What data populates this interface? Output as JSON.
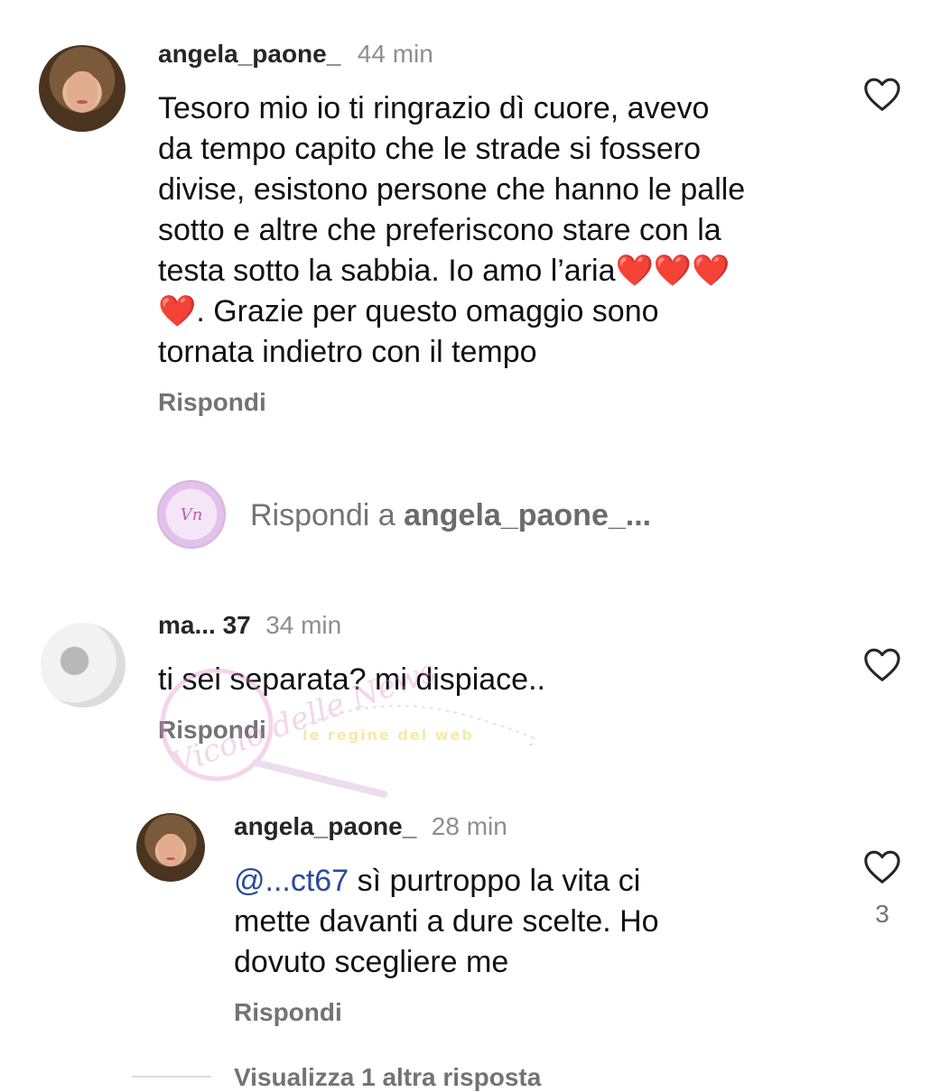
{
  "comments": [
    {
      "username": "angela_paone_",
      "time": "44 min",
      "text_lines": [
        "Tesoro mio io ti ringrazio dì cuore, avevo",
        "da tempo capito che le strade si fossero",
        "divise, esistono persone che hanno le palle",
        "sotto e altre che preferiscono stare con la",
        "testa sotto la sabbia. Io amo l’aria❤️❤️❤️",
        "❤️. Grazie per questo omaggio sono",
        "tornata indietro con il tempo"
      ],
      "reply_label": "Rispondi"
    },
    {
      "username": "ma... 37",
      "time": "34 min",
      "text": "ti sei separata? mi dispiace..",
      "reply_label": "Rispondi"
    }
  ],
  "reply_input": {
    "prefix": "Rispondi a ",
    "target": "angela_paone_..."
  },
  "nested_reply": {
    "username": "angela_paone_",
    "time": "28 min",
    "mention": "@...ct67",
    "line1": " sì purtroppo la vita ci",
    "line2": "mette davanti a dure scelte. Ho",
    "line3": "dovuto scegliere me",
    "reply_label": "Rispondi",
    "likes": "3"
  },
  "view_more": "Visualizza 1 altra risposta",
  "watermark": {
    "logo_text": "Vicolo delle News",
    "tagline": "le regine del web"
  }
}
